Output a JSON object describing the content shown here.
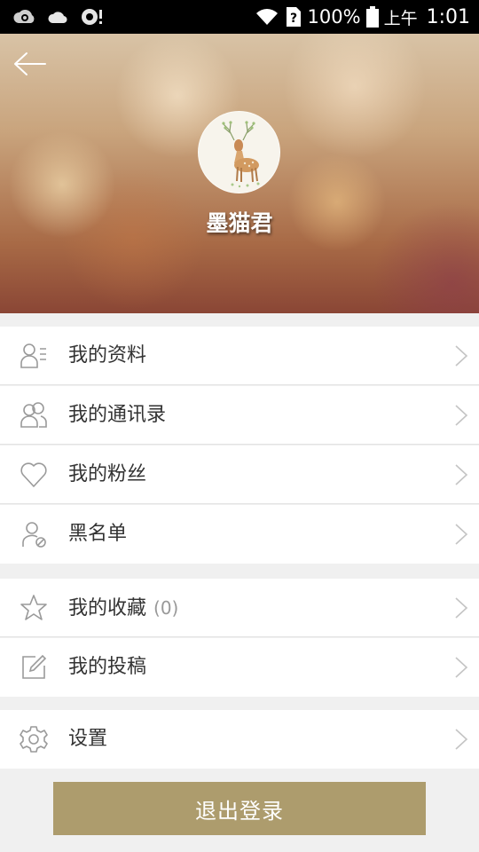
{
  "status_bar": {
    "battery": "100%",
    "ampm": "上午",
    "time": "1:01"
  },
  "profile": {
    "username": "墨猫君"
  },
  "menu": {
    "items": [
      {
        "label": "我的资料",
        "icon": "profile-info-icon"
      },
      {
        "label": "我的通讯录",
        "icon": "contacts-icon"
      },
      {
        "label": "我的粉丝",
        "icon": "heart-icon"
      },
      {
        "label": "黑名单",
        "icon": "blocked-user-icon"
      },
      {
        "label": "我的收藏",
        "count": "(0)",
        "icon": "star-icon"
      },
      {
        "label": "我的投稿",
        "icon": "edit-icon"
      },
      {
        "label": "设置",
        "icon": "gear-icon"
      }
    ]
  },
  "logout": {
    "label": "退出登录"
  },
  "colors": {
    "accent": "#ad9c6d",
    "background": "#f0f0f0",
    "text": "#333333",
    "icon": "#9a9a9a"
  }
}
